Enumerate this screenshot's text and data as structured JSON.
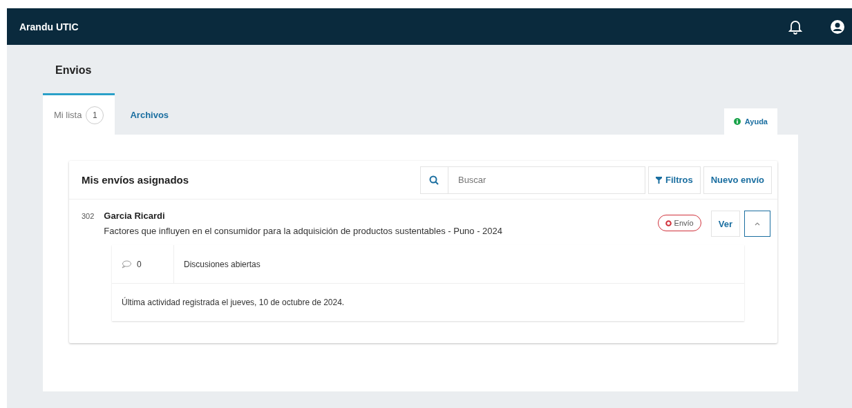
{
  "app": {
    "title": "Arandu UTIC"
  },
  "page": {
    "title": "Envios"
  },
  "tabs": [
    {
      "label": "Mi lista",
      "count": "1",
      "selected": true
    },
    {
      "label": "Archivos",
      "selected": false
    }
  ],
  "help": {
    "label": "Ayuda"
  },
  "list": {
    "title": "Mis envíos asignados",
    "search": {
      "placeholder": "Buscar"
    },
    "filter_button": "Filtros",
    "new_button": "Nuevo envío",
    "items": [
      {
        "id": "302",
        "author": "Garcia Ricardi",
        "title": "Factores que influyen en el consumidor para la adquisición de productos sustentables - Puno - 2024",
        "stage": "Envío",
        "view_button": "Ver",
        "expanded": true,
        "discussions_count": "0",
        "discussions_label": "Discusiones abiertas",
        "last_activity": "Última actividad registrada el jueves, 10 de octubre de 2024."
      }
    ]
  }
}
